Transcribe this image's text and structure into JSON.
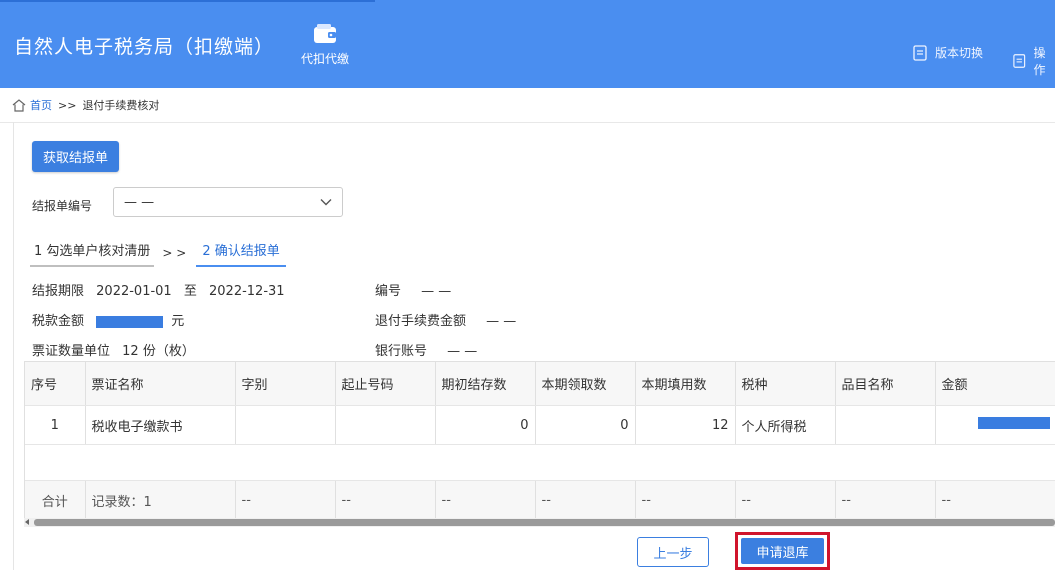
{
  "header": {
    "app_title": "自然人电子税务局（扣缴端）",
    "nav_agent": "代扣代缴",
    "version_switch": "版本切换",
    "operation": "操作"
  },
  "breadcrumb": {
    "home": "首页",
    "sep": ">>",
    "current": "退付手续费核对"
  },
  "actions": {
    "fetch_report": "获取结报单"
  },
  "report_select": {
    "label": "结报单编号",
    "value": "— —"
  },
  "steps": {
    "step1": "1 勾选单户核对清册",
    "sep": "> >",
    "step2": "2 确认结报单"
  },
  "info": {
    "period_label": "结报期限",
    "period_start": "2022-01-01",
    "period_to": "至",
    "period_end": "2022-12-31",
    "number_label": "编号",
    "number_value": "— —",
    "tax_amount_label": "税款金额",
    "tax_amount_unit": "元",
    "refund_fee_label": "退付手续费金额",
    "refund_fee_value": "— —",
    "ticket_qty_label": "票证数量单位",
    "ticket_qty_value": "12 份（枚）",
    "bank_account_label": "银行账号",
    "bank_account_value": "— —"
  },
  "table": {
    "headers": [
      "序号",
      "票证名称",
      "字别",
      "起止号码",
      "期初结存数",
      "本期领取数",
      "本期填用数",
      "税种",
      "品目名称",
      "金额"
    ],
    "row": {
      "seq": "1",
      "name": "税收电子缴款书",
      "zibie": "",
      "range": "",
      "opening": "0",
      "received": "0",
      "used": "12",
      "tax_type": "个人所得税",
      "item": ""
    },
    "summary": {
      "label": "合计",
      "records": "记录数：1",
      "dash": "--"
    }
  },
  "footer": {
    "prev": "上一步",
    "apply": "申请退库"
  },
  "colors": {
    "header_bg": "#4a8ef0",
    "primary": "#3b7fe0",
    "highlight_border": "#d0142c"
  }
}
